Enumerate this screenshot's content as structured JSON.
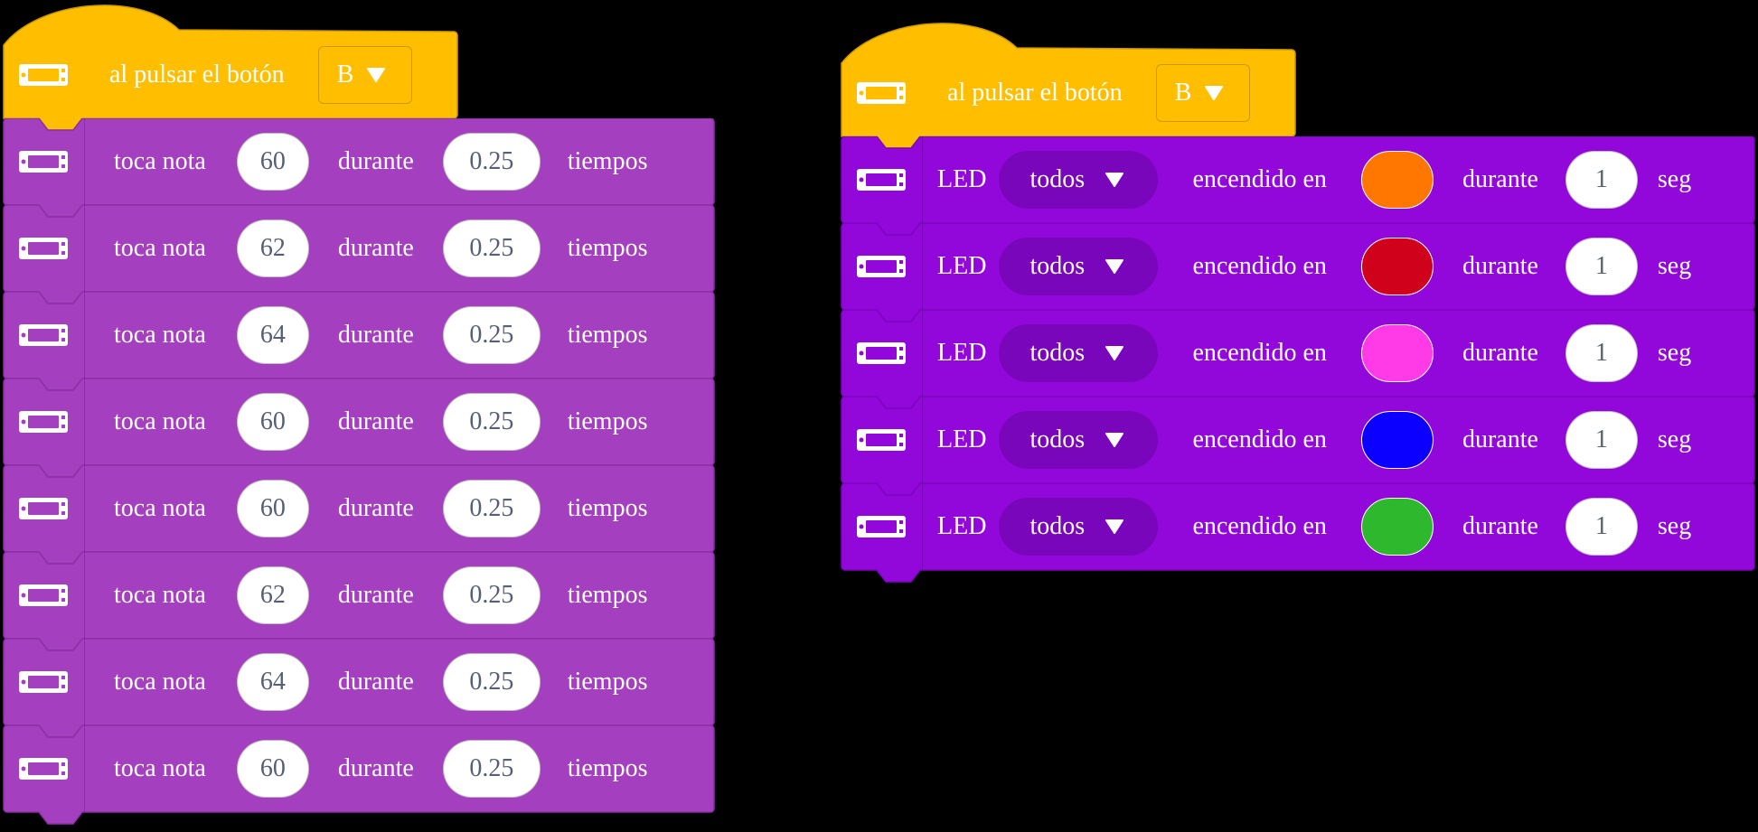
{
  "colors": {
    "events_fill": "#ffbf00",
    "events_stroke": "#cc9900",
    "sound_fill": "#a43fbf",
    "sound_stroke": "#8b2fa3",
    "led_fill": "#9208db",
    "led_stroke": "#7a06bb"
  },
  "left_script": {
    "hat": {
      "icon": "microbit-icon",
      "label": "al pulsar el botón",
      "button_value": "B"
    },
    "blocks": [
      {
        "label": "toca nota",
        "note": "60",
        "mid": "durante",
        "beats": "0.25",
        "unit": "tiempos"
      },
      {
        "label": "toca nota",
        "note": "62",
        "mid": "durante",
        "beats": "0.25",
        "unit": "tiempos"
      },
      {
        "label": "toca nota",
        "note": "64",
        "mid": "durante",
        "beats": "0.25",
        "unit": "tiempos"
      },
      {
        "label": "toca nota",
        "note": "60",
        "mid": "durante",
        "beats": "0.25",
        "unit": "tiempos"
      },
      {
        "label": "toca nota",
        "note": "60",
        "mid": "durante",
        "beats": "0.25",
        "unit": "tiempos"
      },
      {
        "label": "toca nota",
        "note": "62",
        "mid": "durante",
        "beats": "0.25",
        "unit": "tiempos"
      },
      {
        "label": "toca nota",
        "note": "64",
        "mid": "durante",
        "beats": "0.25",
        "unit": "tiempos"
      },
      {
        "label": "toca nota",
        "note": "60",
        "mid": "durante",
        "beats": "0.25",
        "unit": "tiempos"
      }
    ]
  },
  "right_script": {
    "hat": {
      "icon": "microbit-icon",
      "label": "al pulsar el botón",
      "button_value": "B"
    },
    "blocks": [
      {
        "label": "LED",
        "target": "todos",
        "mid": "encendido en",
        "color": "#ff7700",
        "dur_label": "durante",
        "secs": "1",
        "unit": "seg"
      },
      {
        "label": "LED",
        "target": "todos",
        "mid": "encendido en",
        "color": "#d0021b",
        "dur_label": "durante",
        "secs": "1",
        "unit": "seg"
      },
      {
        "label": "LED",
        "target": "todos",
        "mid": "encendido en",
        "color": "#ff3ae6",
        "dur_label": "durante",
        "secs": "1",
        "unit": "seg"
      },
      {
        "label": "LED",
        "target": "todos",
        "mid": "encendido en",
        "color": "#0b00ff",
        "dur_label": "durante",
        "secs": "1",
        "unit": "seg"
      },
      {
        "label": "LED",
        "target": "todos",
        "mid": "encendido en",
        "color": "#2eb82e",
        "dur_label": "durante",
        "secs": "1",
        "unit": "seg"
      }
    ]
  }
}
